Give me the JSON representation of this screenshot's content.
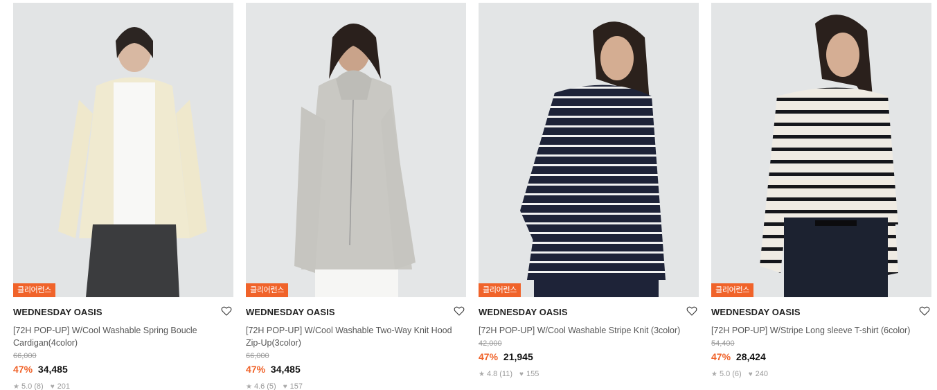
{
  "products": [
    {
      "badge": "클리어런스",
      "brand": "WEDNESDAY OASIS",
      "name": "[72H POP-UP] W/Cool Washable Spring Boucle Cardigan(4color)",
      "original_price": "66,000",
      "discount": "47%",
      "price": "34,485",
      "rating": "5.0",
      "reviews": "(8)",
      "likes": "201",
      "image_icon": "model-cream-cardigan"
    },
    {
      "badge": "클리어런스",
      "brand": "WEDNESDAY OASIS",
      "name": "[72H POP-UP] W/Cool Washable Two-Way Knit Hood Zip-Up(3color)",
      "original_price": "66,000",
      "discount": "47%",
      "price": "34,485",
      "rating": "4.6",
      "reviews": "(5)",
      "likes": "157",
      "image_icon": "model-grey-zip-hoodie"
    },
    {
      "badge": "클리어런스",
      "brand": "WEDNESDAY OASIS",
      "name": "[72H POP-UP] W/Cool Washable Stripe Knit (3color)",
      "original_price": "42,000",
      "discount": "47%",
      "price": "21,945",
      "rating": "4.8",
      "reviews": "(11)",
      "likes": "155",
      "image_icon": "model-navy-stripe-knit"
    },
    {
      "badge": "클리어런스",
      "brand": "WEDNESDAY OASIS",
      "name": "[72H POP-UP] W/Stripe Long sleeve T-shirt (6color)",
      "original_price": "54,400",
      "discount": "47%",
      "price": "28,424",
      "rating": "5.0",
      "reviews": "(6)",
      "likes": "240",
      "image_icon": "model-ivory-stripe-tee"
    }
  ],
  "colors": {
    "accent": "#f0632a",
    "brand_text": "#222222",
    "muted": "#999999"
  },
  "icons": {
    "wishlist": "heart-outline-icon",
    "rating": "star-icon",
    "likes": "heart-filled-icon"
  }
}
